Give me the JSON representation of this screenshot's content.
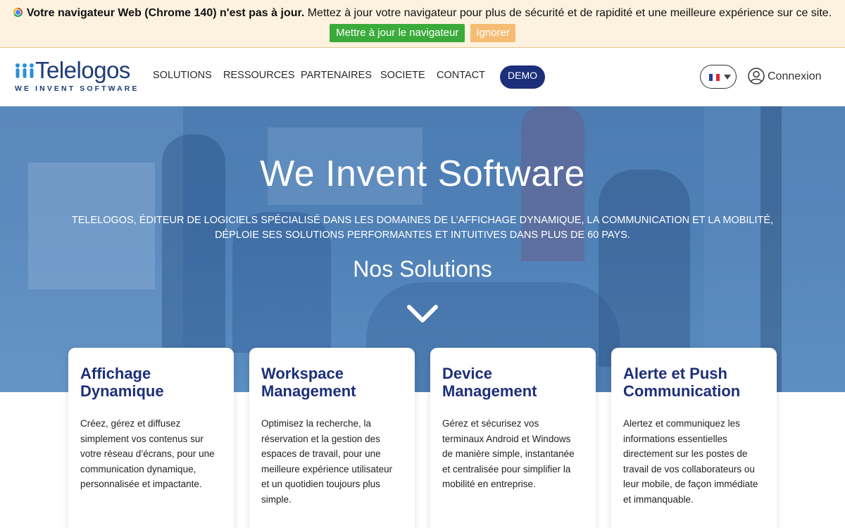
{
  "banner": {
    "bold_text": "Votre navigateur Web (Chrome 140) n'est pas à jour.",
    "text": " Mettez à jour votre navigateur pour plus de sécurité et de rapidité et une meilleure expérience sur ce site.",
    "update_label": "Mettre à jour le navigateur",
    "ignore_label": "Ignorer"
  },
  "header": {
    "logo_name": "Telelogos",
    "logo_tagline": "WE INVENT SOFTWARE",
    "nav": [
      "SOLUTIONS",
      "RESSOURCES",
      "PARTENAIRES",
      "SOCIETE",
      "CONTACT"
    ],
    "demo_label": "DEMO",
    "language_icon": "france-flag-icon",
    "login_label": "Connexion"
  },
  "hero": {
    "title": "We Invent Software",
    "description": "Telelogos, éditeur de logiciels spécialisé dans les domaines de l’affichage dynamique, la communication et la mobilité, déploie ses solutions performantes et intuitives dans plus de 60 pays.",
    "solutions_heading": "Nos Solutions",
    "scroll_icon": "chevron-down-icon"
  },
  "cards": [
    {
      "title": "Affichage Dynamique",
      "text": "Créez, gérez et diffusez simplement vos contenus sur votre réseau d’écrans, pour une communication dynamique, personnalisée et impactante."
    },
    {
      "title": "Workspace Management",
      "text": "Optimisez la recherche, la réservation et la gestion des espaces de travail, pour une meilleure expérience utilisateur et un quotidien toujours plus simple."
    },
    {
      "title": "Device Management",
      "text": "Gérez et sécurisez vos terminaux Android et Windows de manière simple, instantanée et centralisée pour simplifier la mobilité en entreprise."
    },
    {
      "title": "Alerte et Push Communication",
      "text": "Alertez et communiquez les informations essentielles directement sur les postes de travail de vos collaborateurs ou leur mobile, de façon immédiate et immanquable."
    }
  ],
  "colors": {
    "brand_navy": "#1d2f7a",
    "logo_blue": "#1d3b78",
    "update_green": "#3aab3a",
    "ignore_orange": "#f5bd73",
    "banner_bg": "#fdf2df",
    "hero_blue": "#4f80b6"
  }
}
